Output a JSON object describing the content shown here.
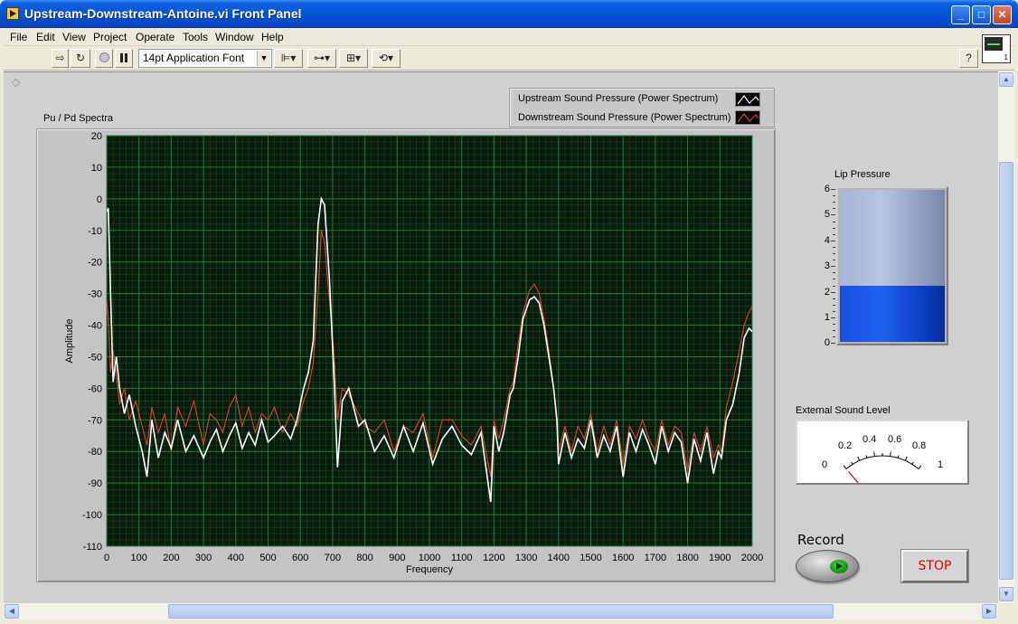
{
  "window": {
    "title": "Upstream-Downstream-Antoine.vi Front Panel",
    "controls": [
      "_",
      "□",
      "✕"
    ]
  },
  "menu": [
    "File",
    "Edit",
    "View",
    "Project",
    "Operate",
    "Tools",
    "Window",
    "Help"
  ],
  "toolbar": {
    "font_select": "14pt Application Font",
    "help_icon": "?",
    "vi_icon_number": "1"
  },
  "graph": {
    "label": "Pu / Pd Spectra",
    "legend": [
      {
        "name": "Upstream Sound Pressure (Power Spectrum)",
        "color": "#ffffff"
      },
      {
        "name": "Downstream Sound Pressure (Power Spectrum)",
        "color": "#e0442c"
      }
    ]
  },
  "chart_data": {
    "type": "line",
    "title": "Pu / Pd Spectra",
    "xlabel": "Frequency",
    "ylabel": "Amplitude",
    "xlim": [
      0,
      2000
    ],
    "ylim": [
      -110,
      20
    ],
    "xticks": [
      0,
      100,
      200,
      300,
      400,
      500,
      600,
      700,
      800,
      900,
      1000,
      1100,
      1200,
      1300,
      1400,
      1500,
      1600,
      1700,
      1800,
      1900,
      2000
    ],
    "yticks": [
      20,
      10,
      0,
      -10,
      -20,
      -30,
      -40,
      -50,
      -60,
      -70,
      -80,
      -90,
      -100,
      -110
    ],
    "grid": true,
    "background": "#0a1a0c",
    "grid_color": "#1f8a3a",
    "series": [
      {
        "name": "Upstream Sound Pressure (Power Spectrum)",
        "color": "#ffffff",
        "x": [
          0,
          5,
          12,
          20,
          30,
          40,
          55,
          70,
          90,
          110,
          125,
          140,
          160,
          180,
          200,
          220,
          245,
          270,
          300,
          320,
          340,
          360,
          380,
          400,
          420,
          440,
          460,
          480,
          500,
          520,
          545,
          570,
          590,
          610,
          625,
          640,
          655,
          665,
          675,
          690,
          705,
          715,
          730,
          750,
          780,
          800,
          830,
          860,
          890,
          920,
          950,
          980,
          1010,
          1040,
          1070,
          1100,
          1130,
          1160,
          1190,
          1200,
          1215,
          1230,
          1250,
          1260,
          1275,
          1290,
          1310,
          1325,
          1340,
          1355,
          1370,
          1385,
          1395,
          1400,
          1420,
          1440,
          1460,
          1480,
          1500,
          1520,
          1540,
          1560,
          1580,
          1600,
          1620,
          1640,
          1660,
          1680,
          1700,
          1720,
          1740,
          1760,
          1780,
          1800,
          1820,
          1840,
          1860,
          1880,
          1895,
          1905,
          1920,
          1940,
          1960,
          1975,
          1990,
          2000
        ],
        "y": [
          -4,
          -3,
          -30,
          -58,
          -50,
          -60,
          -68,
          -62,
          -72,
          -80,
          -88,
          -70,
          -82,
          -74,
          -79,
          -70,
          -80,
          -75,
          -82,
          -77,
          -73,
          -80,
          -75,
          -71,
          -79,
          -74,
          -78,
          -70,
          -77,
          -75,
          -72,
          -76,
          -70,
          -60,
          -55,
          -45,
          -8,
          0,
          -2,
          -25,
          -58,
          -85,
          -64,
          -60,
          -72,
          -70,
          -80,
          -75,
          -82,
          -72,
          -80,
          -71,
          -84,
          -76,
          -72,
          -78,
          -81,
          -74,
          -96,
          -72,
          -80,
          -74,
          -62,
          -60,
          -50,
          -38,
          -32,
          -31,
          -33,
          -40,
          -50,
          -60,
          -70,
          -84,
          -74,
          -82,
          -76,
          -79,
          -70,
          -82,
          -75,
          -80,
          -72,
          -88,
          -74,
          -80,
          -73,
          -78,
          -84,
          -72,
          -80,
          -74,
          -77,
          -90,
          -76,
          -83,
          -74,
          -87,
          -80,
          -82,
          -70,
          -65,
          -55,
          -44,
          -41,
          -42
        ]
      },
      {
        "name": "Downstream Sound Pressure (Power Spectrum)",
        "color": "#e0442c",
        "x": [
          0,
          5,
          12,
          20,
          30,
          40,
          55,
          70,
          90,
          110,
          125,
          140,
          160,
          180,
          200,
          220,
          245,
          270,
          300,
          320,
          340,
          360,
          380,
          400,
          420,
          440,
          460,
          480,
          500,
          520,
          545,
          570,
          590,
          610,
          625,
          640,
          655,
          665,
          675,
          690,
          705,
          715,
          730,
          750,
          780,
          800,
          830,
          860,
          890,
          920,
          950,
          980,
          1010,
          1040,
          1070,
          1100,
          1130,
          1160,
          1190,
          1200,
          1215,
          1230,
          1250,
          1260,
          1275,
          1290,
          1310,
          1325,
          1340,
          1355,
          1370,
          1385,
          1395,
          1400,
          1420,
          1440,
          1460,
          1480,
          1500,
          1520,
          1540,
          1560,
          1580,
          1600,
          1620,
          1640,
          1660,
          1680,
          1700,
          1720,
          1740,
          1760,
          1780,
          1800,
          1820,
          1840,
          1860,
          1880,
          1895,
          1905,
          1920,
          1940,
          1960,
          1975,
          1990,
          2000
        ],
        "y": [
          -32,
          -38,
          -55,
          -48,
          -56,
          -65,
          -60,
          -70,
          -64,
          -72,
          -78,
          -66,
          -74,
          -68,
          -80,
          -66,
          -72,
          -64,
          -78,
          -68,
          -70,
          -74,
          -66,
          -62,
          -72,
          -66,
          -74,
          -68,
          -70,
          -66,
          -74,
          -68,
          -72,
          -64,
          -60,
          -52,
          -30,
          -10,
          -14,
          -32,
          -50,
          -70,
          -60,
          -62,
          -68,
          -72,
          -74,
          -70,
          -80,
          -72,
          -74,
          -68,
          -82,
          -70,
          -70,
          -75,
          -78,
          -72,
          -88,
          -70,
          -76,
          -70,
          -60,
          -58,
          -46,
          -36,
          -29,
          -27,
          -30,
          -38,
          -48,
          -60,
          -72,
          -80,
          -72,
          -80,
          -72,
          -76,
          -68,
          -80,
          -72,
          -78,
          -70,
          -84,
          -72,
          -76,
          -70,
          -76,
          -80,
          -70,
          -78,
          -72,
          -74,
          -86,
          -74,
          -80,
          -72,
          -82,
          -78,
          -80,
          -66,
          -58,
          -48,
          -40,
          -36,
          -34
        ]
      }
    ]
  },
  "lip_pressure": {
    "label": "Lip Pressure",
    "scale": [
      "6",
      "5",
      "4",
      "3",
      "2",
      "1",
      "0"
    ],
    "min": 0,
    "max": 6,
    "value": 2.2,
    "fill_color": "#1a4fe0"
  },
  "external_sound": {
    "label": "External Sound Level",
    "scale": [
      "0",
      "0.2",
      "0.4",
      "0.6",
      "0.8",
      "1"
    ],
    "value": 0,
    "needle_color": "#e00000"
  },
  "record": {
    "label": "Record",
    "lamp_color": "#1ab31a"
  },
  "stop": {
    "label": "STOP",
    "color": "#e00000"
  }
}
